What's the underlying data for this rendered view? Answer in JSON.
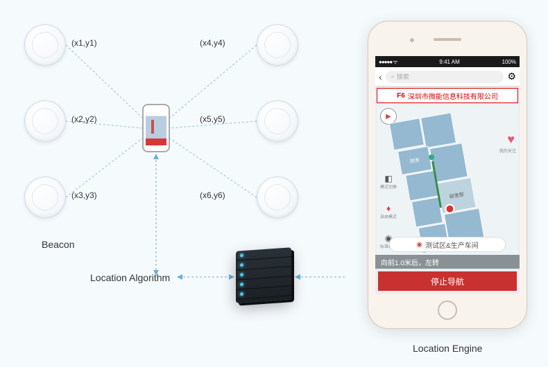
{
  "beacons": [
    {
      "id": "b1",
      "coord": "(x1,y1)"
    },
    {
      "id": "b2",
      "coord": "(x2,y2)"
    },
    {
      "id": "b3",
      "coord": "(x3,y3)"
    },
    {
      "id": "b4",
      "coord": "(x4,y4)"
    },
    {
      "id": "b5",
      "coord": "(x5,y5)"
    },
    {
      "id": "b6",
      "coord": "(x6,y6)"
    }
  ],
  "labels": {
    "beacon": "Beacon",
    "algorithm": "Location Algorithm",
    "engine": "Location Engine"
  },
  "phone": {
    "status": {
      "time": "9:41 AM",
      "battery": "100%"
    },
    "search_placeholder": "搜索",
    "header": {
      "floor": "F6",
      "company": "深圳市微能信息科技有限公司"
    },
    "side_icons": {
      "mode": "模式切换",
      "free": "自由模式",
      "standard": "标准模式"
    },
    "map_labels": {
      "room1": "财务",
      "room2": "研发部",
      "favorite": "我的关注"
    },
    "area_button": "测试区&生产车间",
    "instruction": "向前1.0米后，左转",
    "stop_button": "停止导航"
  }
}
